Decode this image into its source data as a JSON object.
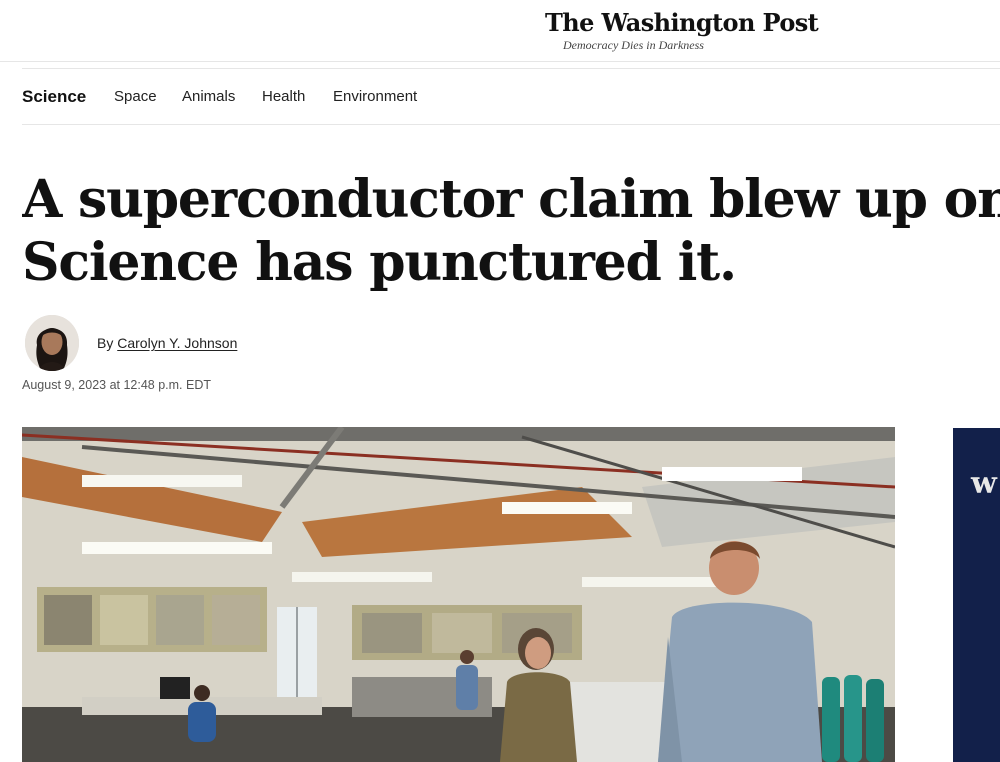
{
  "masthead": {
    "logo": "The Washington Post",
    "tagline": "Democracy Dies in Darkness"
  },
  "section_nav": {
    "items": [
      {
        "label": "Science",
        "active": true
      },
      {
        "label": "Space",
        "active": false
      },
      {
        "label": "Animals",
        "active": false
      },
      {
        "label": "Health",
        "active": false
      },
      {
        "label": "Environment",
        "active": false
      }
    ]
  },
  "article": {
    "headline_line1": "A superconductor claim blew up online.",
    "headline_line2": "Science has punctured it.",
    "byline_prefix": "By",
    "author": "Carolyn Y. Johnson",
    "timestamp": "August 9, 2023 at 12:48 p.m. EDT"
  },
  "ad": {
    "mark": "w"
  },
  "colors": {
    "text": "#111111",
    "muted": "#555555",
    "divider": "#e6e6e6",
    "ad_background": "#12204a"
  }
}
